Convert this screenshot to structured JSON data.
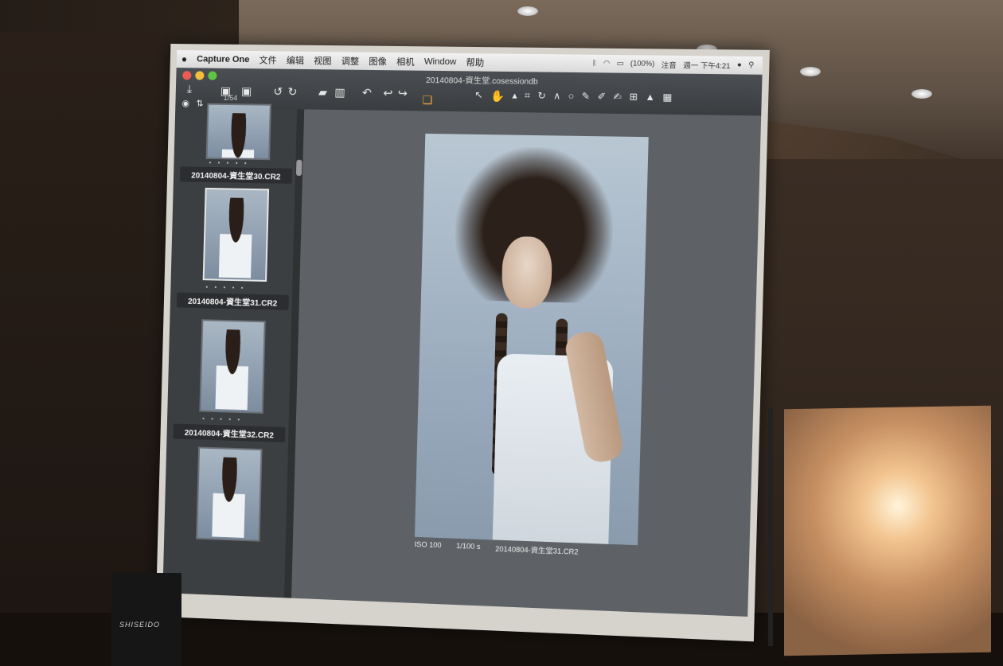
{
  "menubar": {
    "apple": "",
    "app_name": "Capture One",
    "items": [
      "文件",
      "编辑",
      "视图",
      "调整",
      "图像",
      "相机",
      "Window",
      "帮助"
    ],
    "battery": "(100%)",
    "input_method": "注音",
    "clock": "週一 下午4:21"
  },
  "toolbar": {
    "document_title": "20140804-資生堂.cosessiondb",
    "counter": "1/54"
  },
  "browser": {
    "thumbnails": [
      {
        "filename": "20140804-資生堂30.CR2",
        "stars": "• • • • •",
        "selected": false
      },
      {
        "filename": "20140804-資生堂31.CR2",
        "stars": "• • • • •",
        "selected": true
      },
      {
        "filename": "20140804-資生堂32.CR2",
        "stars": "• • • • •",
        "selected": false
      }
    ]
  },
  "viewer": {
    "iso": "ISO 100",
    "shutter": "1/100 s",
    "filename": "20140804-資生堂31.CR2"
  },
  "podium": {
    "logo": "SHISEIDO"
  },
  "colors": {
    "traffic_red": "#ee5b52",
    "traffic_yellow": "#f5bd3a",
    "traffic_green": "#5fc442",
    "accent_orange": "#f0a030"
  }
}
